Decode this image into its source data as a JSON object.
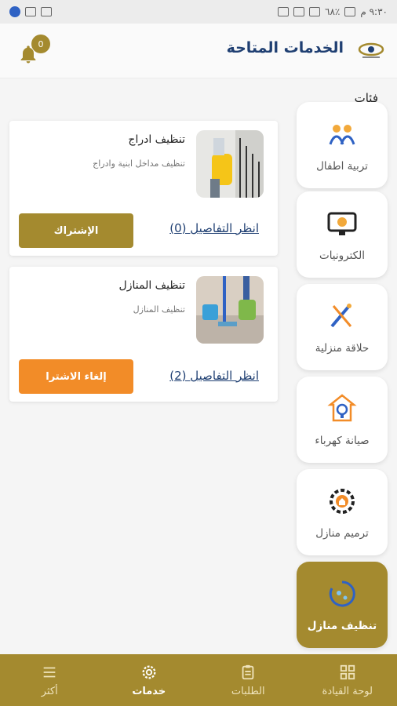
{
  "status_bar": {
    "time": "٩:٣٠ م",
    "battery": "٪٦٨"
  },
  "header": {
    "title": "الخدمات المتاحة",
    "notification_count": "0"
  },
  "categories_label": "فئات",
  "categories": [
    {
      "label": "تربية اطفال",
      "icon": "childcare-icon"
    },
    {
      "label": "الكترونيات",
      "icon": "electronics-icon"
    },
    {
      "label": "حلاقة منزلية",
      "icon": "barber-icon"
    },
    {
      "label": "صيانة كهرباء",
      "icon": "electric-bulb-icon"
    },
    {
      "label": "ترميم منازل",
      "icon": "home-repair-icon"
    },
    {
      "label": "تنظيف منازل",
      "icon": "cleaning-icon",
      "active": true
    }
  ],
  "services": [
    {
      "title": "تنظيف ادراج",
      "description": "تنظيف مداخل ابنية وادراج",
      "details_link": "انظر التفاصيل (0)",
      "action_label": "الإشتراك",
      "action_color": "#a48a2f"
    },
    {
      "title": "تنظيف المنازل",
      "description": "تنظيف المنازل",
      "details_link": "انظر التفاصيل (2)",
      "action_label": "إلغاء الاشترا",
      "action_color": "#f28c28"
    }
  ],
  "bottom_nav": [
    {
      "label": "لوحة القيادة",
      "icon": "dashboard-icon"
    },
    {
      "label": "الطلبات",
      "icon": "clipboard-icon"
    },
    {
      "label": "خدمات",
      "icon": "gear-icon",
      "active": true
    },
    {
      "label": "أكثر",
      "icon": "menu-icon"
    }
  ],
  "colors": {
    "brand": "#a48a2f",
    "title": "#1f3f72",
    "cancel": "#f28c28"
  }
}
